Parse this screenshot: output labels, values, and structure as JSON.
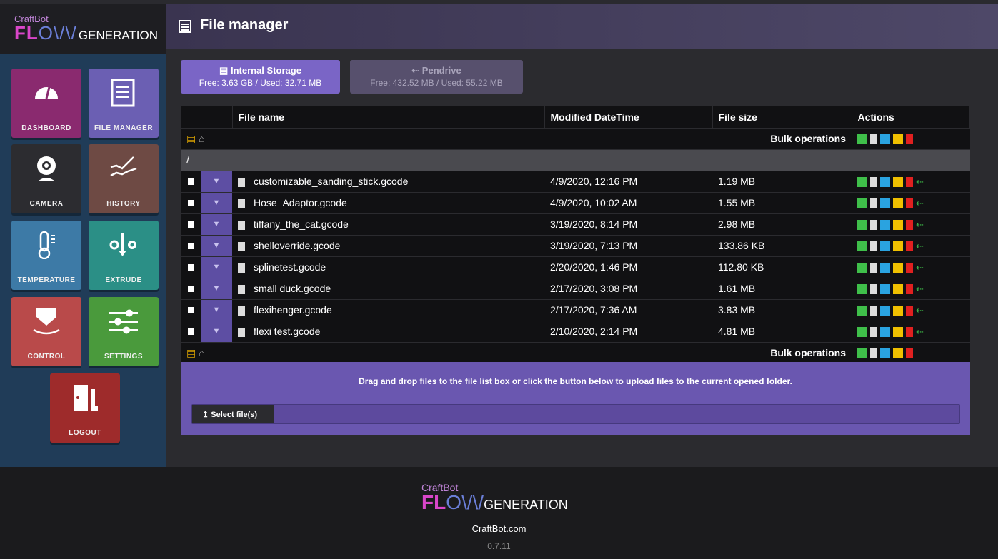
{
  "brand": {
    "top": "CraftBot",
    "flow_a": "FL",
    "flow_b": "O∧∕",
    "gen": "GENERATION"
  },
  "sidebar": {
    "tiles": [
      {
        "label": "DASHBOARD"
      },
      {
        "label": "FILE MANAGER"
      },
      {
        "label": "CAMERA"
      },
      {
        "label": "HISTORY"
      },
      {
        "label": "TEMPERATURE"
      },
      {
        "label": "EXTRUDE"
      },
      {
        "label": "CONTROL"
      },
      {
        "label": "SETTINGS"
      },
      {
        "label": "LOGOUT"
      }
    ]
  },
  "header": {
    "title": "File manager"
  },
  "storage": {
    "internal": {
      "name": "Internal Storage",
      "stats": "Free: 3.63 GB / Used: 32.71 MB"
    },
    "pendrive": {
      "name": "Pendrive",
      "stats": "Free: 432.52 MB / Used: 55.22 MB"
    }
  },
  "table": {
    "headers": {
      "name": "File name",
      "modified": "Modified DateTime",
      "size": "File size",
      "actions": "Actions"
    },
    "bulk_label": "Bulk operations",
    "path": "/",
    "rows": [
      {
        "name": "customizable_sanding_stick.gcode",
        "modified": "4/9/2020, 12:16 PM",
        "size": "1.19 MB"
      },
      {
        "name": "Hose_Adaptor.gcode",
        "modified": "4/9/2020, 10:02 AM",
        "size": "1.55 MB"
      },
      {
        "name": "tiffany_the_cat.gcode",
        "modified": "3/19/2020, 8:14 PM",
        "size": "2.98 MB"
      },
      {
        "name": "shelloverride.gcode",
        "modified": "3/19/2020, 7:13 PM",
        "size": "133.86 KB"
      },
      {
        "name": "splinetest.gcode",
        "modified": "2/20/2020, 1:46 PM",
        "size": "112.80 KB"
      },
      {
        "name": "small duck.gcode",
        "modified": "2/17/2020, 3:08 PM",
        "size": "1.61 MB"
      },
      {
        "name": "flexihenger.gcode",
        "modified": "2/17/2020, 7:36 AM",
        "size": "3.83 MB"
      },
      {
        "name": "flexi test.gcode",
        "modified": "2/10/2020, 2:14 PM",
        "size": "4.81 MB"
      }
    ]
  },
  "upload": {
    "message": "Drag and drop files to the file list box or click the button below to upload files to the current opened folder.",
    "button": "Select file(s)"
  },
  "footer": {
    "site": "CraftBot.com",
    "version": "0.7.11"
  },
  "colors": {
    "accent": "#7a65c6",
    "download": "#3fbf4a",
    "copy": "#2aa3e0",
    "cut": "#f0c000",
    "delete": "#e02020",
    "usb": "#3fbf4a"
  }
}
